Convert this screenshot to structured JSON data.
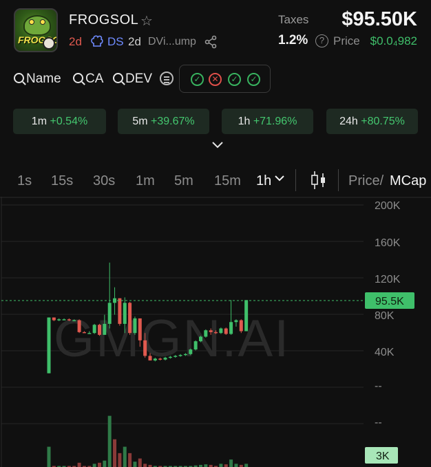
{
  "token": {
    "name": "FROGSOL",
    "logo_text": "FROGSOL",
    "age": "2d",
    "ds_label": "DS",
    "ds_age": "2d",
    "dev_tag": "DVi...ump",
    "taxes_label": "Taxes",
    "market_cap": "$95.50K",
    "tax_value": "1.2%",
    "price_label": "Price",
    "price_value": "$0.0₄982"
  },
  "search": {
    "name": "Name",
    "ca": "CA",
    "dev": "DEV"
  },
  "checks": [
    "ok",
    "bad",
    "ok",
    "ok"
  ],
  "changes": [
    {
      "period": "1m",
      "value": "+0.54%"
    },
    {
      "period": "5m",
      "value": "+39.67%"
    },
    {
      "period": "1h",
      "value": "+71.96%"
    },
    {
      "period": "24h",
      "value": "+80.75%"
    }
  ],
  "timeframes": [
    "1s",
    "15s",
    "30s",
    "1m",
    "5m",
    "15m",
    "1h"
  ],
  "active_timeframe": "1h",
  "toggle": {
    "price": "Price/",
    "mcap": "MCap"
  },
  "colors": {
    "up": "#3fbf6a",
    "down": "#e0594f",
    "accent_ds": "#6f8bff"
  },
  "chart_data": {
    "type": "candlestick",
    "watermark": "GMGN.AI",
    "y_axis_labels": [
      "200K",
      "160K",
      "120K",
      "80K",
      "40K",
      "--"
    ],
    "current_value_label": "95.5K",
    "current_value": 95.5,
    "volume_axis_labels": [
      "--"
    ],
    "volume_label": "3K",
    "ylim": [
      0,
      200
    ],
    "unit": "K",
    "candles": [
      {
        "o": 16,
        "h": 77,
        "l": 16,
        "c": 77
      },
      {
        "o": 77,
        "h": 77,
        "l": 73,
        "c": 74
      },
      {
        "o": 74,
        "h": 76,
        "l": 73,
        "c": 75
      },
      {
        "o": 75,
        "h": 76,
        "l": 74,
        "c": 75
      },
      {
        "o": 75,
        "h": 76,
        "l": 73,
        "c": 74
      },
      {
        "o": 74,
        "h": 75,
        "l": 73,
        "c": 74
      },
      {
        "o": 74,
        "h": 75,
        "l": 60,
        "c": 61
      },
      {
        "o": 61,
        "h": 62,
        "l": 60,
        "c": 60
      },
      {
        "o": 60,
        "h": 62,
        "l": 59,
        "c": 60
      },
      {
        "o": 60,
        "h": 70,
        "l": 59,
        "c": 69
      },
      {
        "o": 69,
        "h": 70,
        "l": 57,
        "c": 58
      },
      {
        "o": 58,
        "h": 80,
        "l": 58,
        "c": 70
      },
      {
        "o": 70,
        "h": 137,
        "l": 65,
        "c": 93
      },
      {
        "o": 93,
        "h": 110,
        "l": 80,
        "c": 98
      },
      {
        "o": 98,
        "h": 98,
        "l": 68,
        "c": 70
      },
      {
        "o": 70,
        "h": 99,
        "l": 60,
        "c": 93
      },
      {
        "o": 93,
        "h": 94,
        "l": 58,
        "c": 60
      },
      {
        "o": 60,
        "h": 78,
        "l": 58,
        "c": 76
      },
      {
        "o": 76,
        "h": 76,
        "l": 45,
        "c": 52
      },
      {
        "o": 52,
        "h": 60,
        "l": 33,
        "c": 35
      },
      {
        "o": 35,
        "h": 38,
        "l": 30,
        "c": 30
      },
      {
        "o": 30,
        "h": 33,
        "l": 29,
        "c": 32
      },
      {
        "o": 32,
        "h": 33,
        "l": 30,
        "c": 31
      },
      {
        "o": 31,
        "h": 34,
        "l": 30,
        "c": 33
      },
      {
        "o": 33,
        "h": 35,
        "l": 32,
        "c": 34
      },
      {
        "o": 34,
        "h": 36,
        "l": 33,
        "c": 35
      },
      {
        "o": 35,
        "h": 37,
        "l": 34,
        "c": 36
      },
      {
        "o": 36,
        "h": 38,
        "l": 35,
        "c": 37
      },
      {
        "o": 37,
        "h": 43,
        "l": 36,
        "c": 42
      },
      {
        "o": 42,
        "h": 52,
        "l": 41,
        "c": 51
      },
      {
        "o": 51,
        "h": 57,
        "l": 50,
        "c": 56
      },
      {
        "o": 56,
        "h": 64,
        "l": 55,
        "c": 63
      },
      {
        "o": 63,
        "h": 65,
        "l": 58,
        "c": 61
      },
      {
        "o": 61,
        "h": 63,
        "l": 59,
        "c": 60
      },
      {
        "o": 60,
        "h": 66,
        "l": 59,
        "c": 65
      },
      {
        "o": 65,
        "h": 66,
        "l": 58,
        "c": 59
      },
      {
        "o": 59,
        "h": 96,
        "l": 58,
        "c": 72
      },
      {
        "o": 72,
        "h": 75,
        "l": 67,
        "c": 74
      },
      {
        "o": 74,
        "h": 75,
        "l": 60,
        "c": 62
      },
      {
        "o": 62,
        "h": 96,
        "l": 62,
        "c": 96
      }
    ],
    "volumes": [
      {
        "v": 1.9,
        "up": true
      },
      {
        "v": 0.1,
        "up": false
      },
      {
        "v": 0.05,
        "up": true
      },
      {
        "v": 0.05,
        "up": true
      },
      {
        "v": 0.05,
        "up": false
      },
      {
        "v": 0.05,
        "up": false
      },
      {
        "v": 0.4,
        "up": false
      },
      {
        "v": 0.05,
        "up": false
      },
      {
        "v": 0.05,
        "up": false
      },
      {
        "v": 0.3,
        "up": true
      },
      {
        "v": 0.4,
        "up": false
      },
      {
        "v": 0.6,
        "up": true
      },
      {
        "v": 4.8,
        "up": true
      },
      {
        "v": 2.6,
        "up": false
      },
      {
        "v": 1.3,
        "up": false
      },
      {
        "v": 1.9,
        "up": true
      },
      {
        "v": 1.3,
        "up": false
      },
      {
        "v": 0.5,
        "up": true
      },
      {
        "v": 0.8,
        "up": false
      },
      {
        "v": 0.3,
        "up": false
      },
      {
        "v": 0.2,
        "up": false
      },
      {
        "v": 0.1,
        "up": true
      },
      {
        "v": 0.05,
        "up": false
      },
      {
        "v": 0.05,
        "up": true
      },
      {
        "v": 0.05,
        "up": true
      },
      {
        "v": 0.05,
        "up": true
      },
      {
        "v": 0.05,
        "up": true
      },
      {
        "v": 0.05,
        "up": true
      },
      {
        "v": 0.1,
        "up": true
      },
      {
        "v": 0.15,
        "up": true
      },
      {
        "v": 0.2,
        "up": true
      },
      {
        "v": 0.25,
        "up": true
      },
      {
        "v": 0.2,
        "up": false
      },
      {
        "v": 0.1,
        "up": false
      },
      {
        "v": 0.3,
        "up": true
      },
      {
        "v": 0.25,
        "up": false
      },
      {
        "v": 0.7,
        "up": true
      },
      {
        "v": 0.3,
        "up": true
      },
      {
        "v": 0.2,
        "up": false
      },
      {
        "v": 0.3,
        "up": true
      }
    ]
  }
}
